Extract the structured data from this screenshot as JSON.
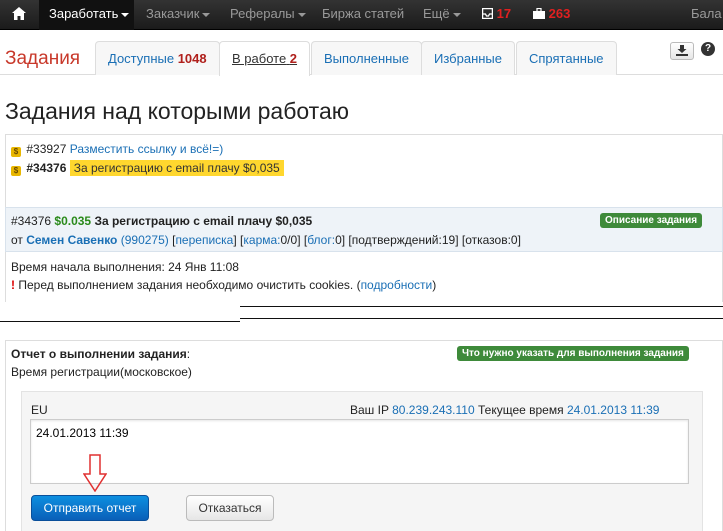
{
  "navbar": {
    "items": [
      {
        "label": "Заработать"
      },
      {
        "label": "Заказчик"
      },
      {
        "label": "Рефералы"
      },
      {
        "label": "Биржа статей"
      },
      {
        "label": "Ещё"
      }
    ],
    "mail_count": "17",
    "jobs_count": "263",
    "balance_label": "Бала"
  },
  "tabs": {
    "section_title": "Задания",
    "items": [
      {
        "label": "Доступные",
        "count": "1048"
      },
      {
        "label": "В работе",
        "count": "2"
      },
      {
        "label": "Выполненные"
      },
      {
        "label": "Избранные"
      },
      {
        "label": "Спрятанные"
      }
    ]
  },
  "page_title": "Задания над которыми работаю",
  "task_list": [
    {
      "id": "#33927",
      "title": "Разместить ссылку и всё!=)"
    },
    {
      "id": "#34376",
      "title": "За регистрацию с email плачу $0,035"
    }
  ],
  "task_detail": {
    "id": "#34376",
    "price": "$0.035",
    "title": "За регистрацию с email плачу $0,035",
    "description_label": "Описание задания",
    "author_prefix": "от",
    "author_name": "Семен Савенко",
    "author_id": "(990275)",
    "perepiska": "переписка",
    "karma_label": "карма:",
    "karma_value": "0/0",
    "blog_label": "блог:",
    "blog_value": "0",
    "confirmations": "подтверждений:19",
    "refusals": "отказов:0",
    "start_time_label": "Время начала выполнения:",
    "start_time_value": "24 Янв 11:08",
    "notice_mark": "!",
    "notice_text": "Перед выполнением задания необходимо очистить cookies. (",
    "notice_link": "подробности",
    "notice_end": ")"
  },
  "report": {
    "title": "Отчет о выполнении задания",
    "title_suffix": ":",
    "requirement_label": "Что нужно указать для выполнения задания",
    "requirement_text": "Время регистрации(московское)",
    "region": "EU",
    "ip_label": "Ваш IP",
    "ip_value": "80.239.243.110",
    "time_label": "Текущее время",
    "time_value": "24.01.2013 11:39",
    "input_value": "24.01.2013 11:39",
    "submit_label": "Отправить отчет",
    "refuse_label": "Отказаться"
  },
  "colors": {
    "accent_blue": "#1a6fb5",
    "price_green": "#2a8a1a",
    "highlight_yellow": "#ffd72e",
    "label_green": "#3e8a3a",
    "title_red": "#c8382a"
  }
}
